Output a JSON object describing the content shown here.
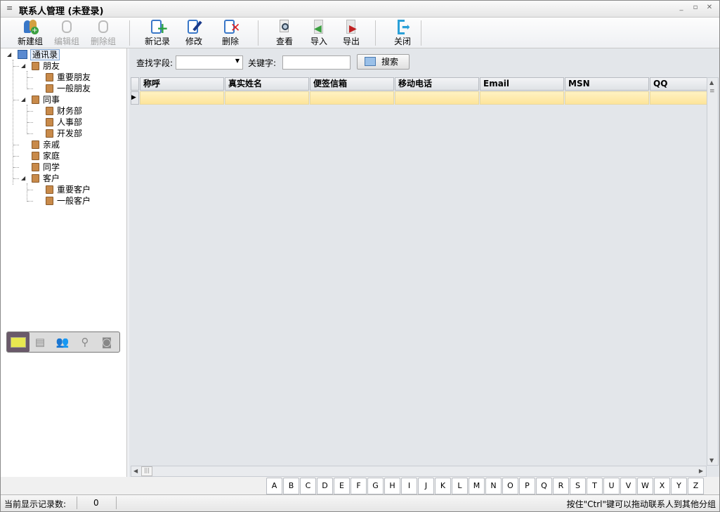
{
  "window": {
    "title": "联系人管理 (未登录)",
    "menu_icon": "≡",
    "minimize": "_",
    "restore": "▫",
    "close": "✕"
  },
  "toolbar": [
    {
      "label": "新建组",
      "icon": "add-group-icon",
      "enabled": true
    },
    {
      "label": "编辑组",
      "icon": "edit-group-icon",
      "enabled": false
    },
    {
      "label": "删除组",
      "icon": "delete-group-icon",
      "enabled": false
    },
    {
      "label": "新记录",
      "icon": "new-record-icon",
      "enabled": true
    },
    {
      "label": "修改",
      "icon": "edit-record-icon",
      "enabled": true
    },
    {
      "label": "删除",
      "icon": "delete-record-icon",
      "enabled": true
    },
    {
      "label": "查看",
      "icon": "view-icon",
      "enabled": true
    },
    {
      "label": "导入",
      "icon": "import-icon",
      "enabled": true
    },
    {
      "label": "导出",
      "icon": "export-icon",
      "enabled": true
    },
    {
      "label": "关闭",
      "icon": "close-app-icon",
      "enabled": true
    }
  ],
  "tree": {
    "root": "通讯录",
    "nodes": [
      {
        "label": "朋友",
        "level": 1
      },
      {
        "label": "重要朋友",
        "level": 2
      },
      {
        "label": "一般朋友",
        "level": 2
      },
      {
        "label": "同事",
        "level": 1
      },
      {
        "label": "财务部",
        "level": 2
      },
      {
        "label": "人事部",
        "level": 2
      },
      {
        "label": "开发部",
        "level": 2
      },
      {
        "label": "亲戚",
        "level": 1
      },
      {
        "label": "家庭",
        "level": 1
      },
      {
        "label": "同学",
        "level": 1
      },
      {
        "label": "客户",
        "level": 1
      },
      {
        "label": "重要客户",
        "level": 2
      },
      {
        "label": "一般客户",
        "level": 2
      }
    ]
  },
  "search": {
    "field_label": "查找字段:",
    "field_value": "",
    "keyword_label": "关键字:",
    "keyword_value": "",
    "button": "搜索"
  },
  "grid": {
    "columns": [
      "称呼",
      "真实姓名",
      "便签信箱",
      "移动电话",
      "Email",
      "MSN",
      "QQ"
    ],
    "rows": [
      [
        "",
        "",
        "",
        "",
        "",
        "",
        ""
      ]
    ]
  },
  "letters": [
    "A",
    "B",
    "C",
    "D",
    "E",
    "F",
    "G",
    "H",
    "I",
    "J",
    "K",
    "L",
    "M",
    "N",
    "O",
    "P",
    "Q",
    "R",
    "S",
    "T",
    "U",
    "V",
    "W",
    "X",
    "Y",
    "Z"
  ],
  "status": {
    "count_label": "当前显示记录数:",
    "count": "0",
    "hint": "按住\"Ctrl\"键可以拖动联系人到其他分组"
  }
}
